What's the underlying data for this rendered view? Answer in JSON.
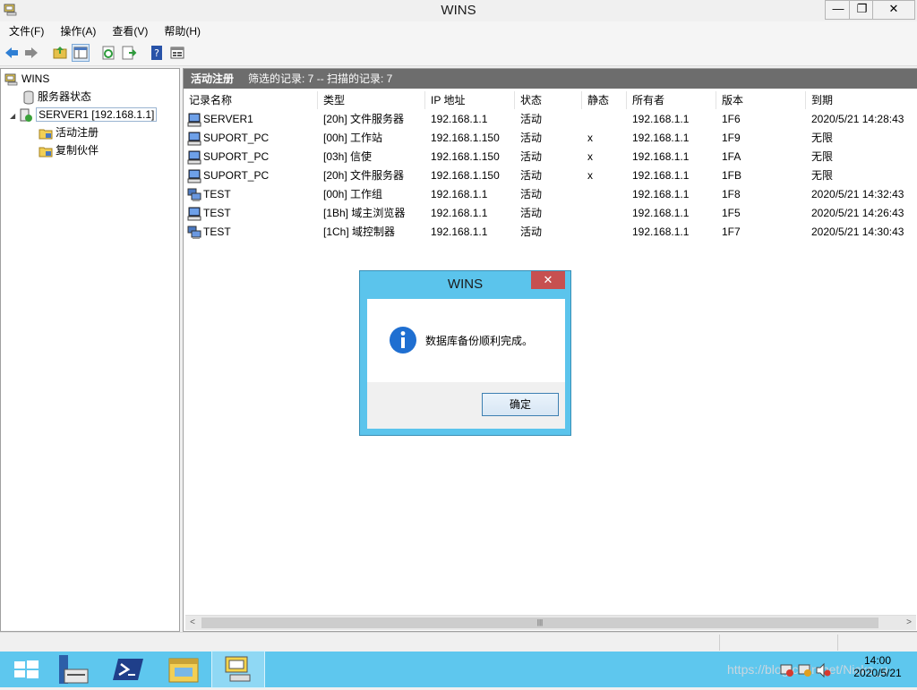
{
  "window": {
    "title": "WINS",
    "minimize_label": "—",
    "restore_label": "❐",
    "close_label": "✕"
  },
  "menu": {
    "items": [
      {
        "label": "文件(F)"
      },
      {
        "label": "操作(A)"
      },
      {
        "label": "查看(V)"
      },
      {
        "label": "帮助(H)"
      }
    ]
  },
  "toolbar": {
    "icons": [
      "back-arrow-icon",
      "forward-arrow-icon",
      "up-folder-icon",
      "show-hide-tree-icon",
      "refresh-icon",
      "export-list-icon",
      "help-icon",
      "properties-icon"
    ]
  },
  "tree": {
    "root": "WINS",
    "server_status": "服务器状态",
    "server": "SERVER1 [192.168.1.1]",
    "active_registrations": "活动注册",
    "replication_partners": "复制伙伴"
  },
  "pane": {
    "header_title": "活动注册",
    "header_info": "筛选的记录: 7 -- 扫描的记录: 7"
  },
  "table": {
    "columns": [
      "记录名称",
      "类型",
      "IP 地址",
      "状态",
      "静态",
      "所有者",
      "版本",
      "到期"
    ],
    "rows": [
      {
        "name": "SERVER1",
        "type": "[20h] 文件服务器",
        "ip": "192.168.1.1",
        "state": "活动",
        "static": "",
        "owner": "192.168.1.1",
        "version": "1F6",
        "expires": "2020/5/21 14:28:43",
        "icon": "computer-icon"
      },
      {
        "name": "SUPORT_PC",
        "type": "[00h] 工作站",
        "ip": "192.168.1.150",
        "state": "活动",
        "static": "x",
        "owner": "192.168.1.1",
        "version": "1F9",
        "expires": "无限",
        "icon": "computer-icon"
      },
      {
        "name": "SUPORT_PC",
        "type": "[03h] 信使",
        "ip": "192.168.1.150",
        "state": "活动",
        "static": "x",
        "owner": "192.168.1.1",
        "version": "1FA",
        "expires": "无限",
        "icon": "computer-icon"
      },
      {
        "name": "SUPORT_PC",
        "type": "[20h] 文件服务器",
        "ip": "192.168.1.150",
        "state": "活动",
        "static": "x",
        "owner": "192.168.1.1",
        "version": "1FB",
        "expires": "无限",
        "icon": "computer-icon"
      },
      {
        "name": "TEST",
        "type": "[00h] 工作组",
        "ip": "192.168.1.1",
        "state": "活动",
        "static": "",
        "owner": "192.168.1.1",
        "version": "1F8",
        "expires": "2020/5/21 14:32:43",
        "icon": "group-icon"
      },
      {
        "name": "TEST",
        "type": "[1Bh] 域主浏览器",
        "ip": "192.168.1.1",
        "state": "活动",
        "static": "",
        "owner": "192.168.1.1",
        "version": "1F5",
        "expires": "2020/5/21 14:26:43",
        "icon": "computer-icon"
      },
      {
        "name": "TEST",
        "type": "[1Ch] 域控制器",
        "ip": "192.168.1.1",
        "state": "活动",
        "static": "",
        "owner": "192.168.1.1",
        "version": "1F7",
        "expires": "2020/5/21 14:30:43",
        "icon": "group-icon"
      }
    ]
  },
  "scrollbar": {
    "left_arrow": "<",
    "right_arrow": ">",
    "thumb_grip": "|||"
  },
  "dialog": {
    "title": "WINS",
    "close_label": "✕",
    "message": "数据库备份顺利完成。",
    "ok_label": "确定",
    "icon": "info-icon"
  },
  "taskbar": {
    "apps": [
      "windows-start-icon",
      "server-manager-icon",
      "powershell-icon",
      "file-explorer-icon",
      "wins-app-icon"
    ],
    "clock_time": "14:00",
    "clock_date": "2020/5/21",
    "watermark": "https://blog.csdn.net/Nicks_u"
  }
}
